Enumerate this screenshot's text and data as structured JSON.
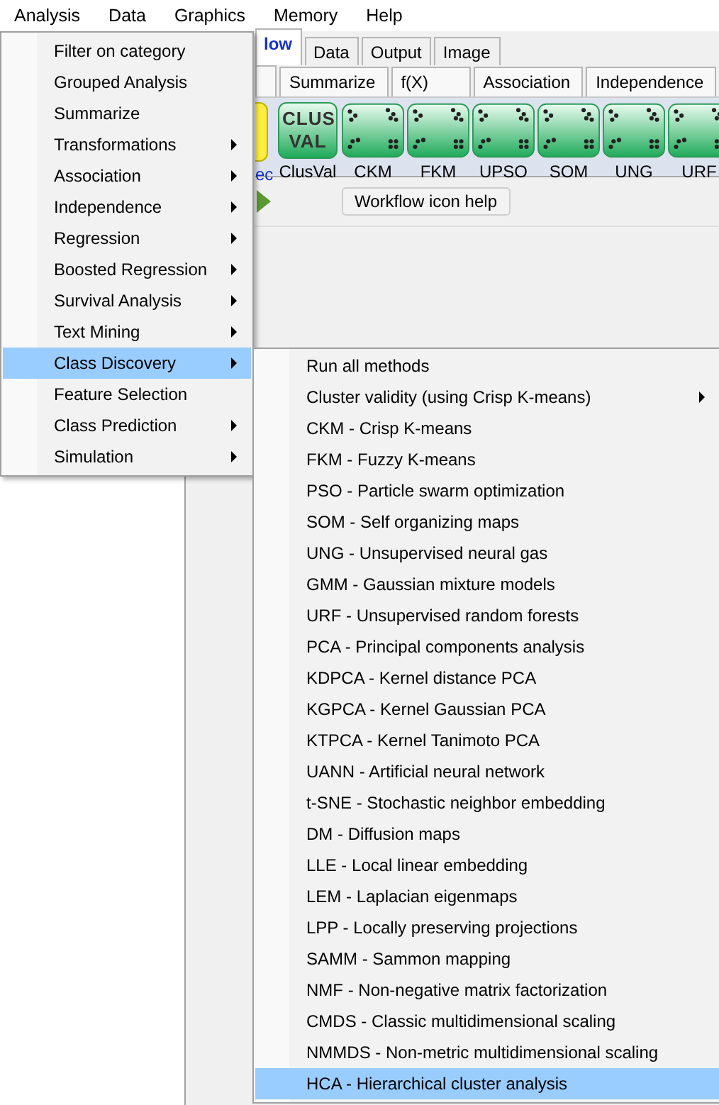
{
  "menubar": [
    {
      "label": "Analysis"
    },
    {
      "label": "Data"
    },
    {
      "label": "Graphics"
    },
    {
      "label": "Memory"
    },
    {
      "label": "Help"
    }
  ],
  "tabs_row1": [
    {
      "label": "low",
      "selected": true
    },
    {
      "label": "Data",
      "selected": false
    },
    {
      "label": "Output",
      "selected": false
    },
    {
      "label": "Image",
      "selected": false
    }
  ],
  "tabs_row2": [
    {
      "label": "Summarize"
    },
    {
      "label": "f(X)"
    },
    {
      "label": "Association"
    },
    {
      "label": "Independence"
    }
  ],
  "workflow_icons": [
    {
      "kind": "partial",
      "label": "ec"
    },
    {
      "kind": "text",
      "icon_text": "CLUS VAL",
      "label": "ClusVal"
    },
    {
      "kind": "dots",
      "label": "CKM"
    },
    {
      "kind": "dots",
      "label": "FKM"
    },
    {
      "kind": "dots",
      "label": "UPSO"
    },
    {
      "kind": "dots",
      "label": "SOM"
    },
    {
      "kind": "dots",
      "label": "UNG"
    },
    {
      "kind": "dots",
      "label": "URF"
    }
  ],
  "help_button": "Workflow icon help",
  "analysis_menu": [
    {
      "label": "Filter on category",
      "submenu": false,
      "selected": false
    },
    {
      "label": "Grouped Analysis",
      "submenu": false,
      "selected": false
    },
    {
      "label": "Summarize",
      "submenu": false,
      "selected": false
    },
    {
      "label": "Transformations",
      "submenu": true,
      "selected": false
    },
    {
      "label": "Association",
      "submenu": true,
      "selected": false
    },
    {
      "label": "Independence",
      "submenu": true,
      "selected": false
    },
    {
      "label": "Regression",
      "submenu": true,
      "selected": false
    },
    {
      "label": "Boosted Regression",
      "submenu": true,
      "selected": false
    },
    {
      "label": "Survival Analysis",
      "submenu": true,
      "selected": false
    },
    {
      "label": "Text Mining",
      "submenu": true,
      "selected": false
    },
    {
      "label": "Class Discovery",
      "submenu": true,
      "selected": true
    },
    {
      "label": "Feature Selection",
      "submenu": false,
      "selected": false
    },
    {
      "label": "Class Prediction",
      "submenu": true,
      "selected": false
    },
    {
      "label": "Simulation",
      "submenu": true,
      "selected": false
    }
  ],
  "class_discovery_menu": [
    {
      "label": "Run all methods",
      "submenu": false,
      "selected": false
    },
    {
      "label": "Cluster validity (using Crisp K-means)",
      "submenu": true,
      "selected": false
    },
    {
      "label": "CKM - Crisp K-means",
      "submenu": false,
      "selected": false
    },
    {
      "label": "FKM - Fuzzy K-means",
      "submenu": false,
      "selected": false
    },
    {
      "label": "PSO - Particle swarm optimization",
      "submenu": false,
      "selected": false
    },
    {
      "label": "SOM - Self organizing maps",
      "submenu": false,
      "selected": false
    },
    {
      "label": "UNG - Unsupervised neural gas",
      "submenu": false,
      "selected": false
    },
    {
      "label": "GMM - Gaussian mixture models",
      "submenu": false,
      "selected": false
    },
    {
      "label": "URF - Unsupervised random forests",
      "submenu": false,
      "selected": false
    },
    {
      "label": "PCA - Principal components analysis",
      "submenu": false,
      "selected": false
    },
    {
      "label": "KDPCA - Kernel distance PCA",
      "submenu": false,
      "selected": false
    },
    {
      "label": "KGPCA - Kernel Gaussian PCA",
      "submenu": false,
      "selected": false
    },
    {
      "label": "KTPCA - Kernel Tanimoto PCA",
      "submenu": false,
      "selected": false
    },
    {
      "label": "UANN - Artificial neural network",
      "submenu": false,
      "selected": false
    },
    {
      "label": "t-SNE - Stochastic neighbor embedding",
      "submenu": false,
      "selected": false
    },
    {
      "label": "DM - Diffusion maps",
      "submenu": false,
      "selected": false
    },
    {
      "label": "LLE - Local linear embedding",
      "submenu": false,
      "selected": false
    },
    {
      "label": "LEM - Laplacian eigenmaps",
      "submenu": false,
      "selected": false
    },
    {
      "label": "LPP - Locally preserving projections",
      "submenu": false,
      "selected": false
    },
    {
      "label": "SAMM - Sammon mapping",
      "submenu": false,
      "selected": false
    },
    {
      "label": "NMF - Non-negative matrix factorization",
      "submenu": false,
      "selected": false
    },
    {
      "label": "CMDS - Classic multidimensional scaling",
      "submenu": false,
      "selected": false
    },
    {
      "label": "NMMDS - Non-metric multidimensional scaling",
      "submenu": false,
      "selected": false
    },
    {
      "label": "HCA - Hierarchical cluster analysis",
      "submenu": false,
      "selected": true
    }
  ]
}
